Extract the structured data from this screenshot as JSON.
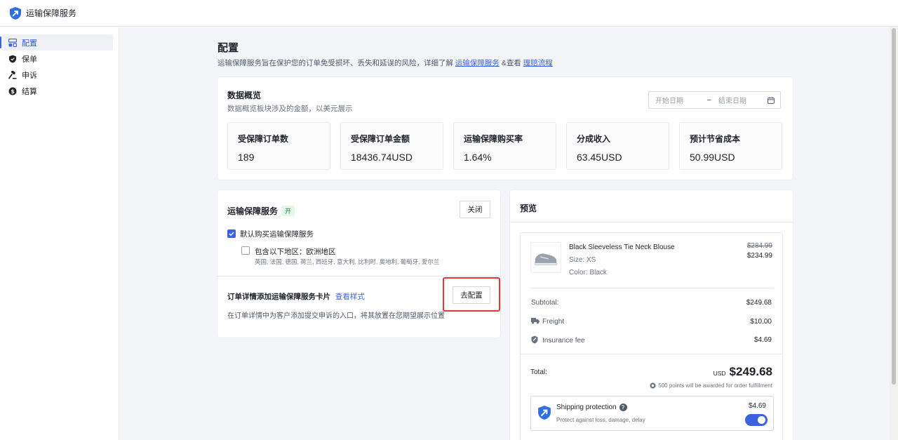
{
  "app": {
    "title": "运输保障服务"
  },
  "sidebar": {
    "items": [
      {
        "label": "配置",
        "icon": "settings-grid-icon",
        "active": true
      },
      {
        "label": "保单",
        "icon": "shield-icon",
        "active": false
      },
      {
        "label": "申诉",
        "icon": "gavel-icon",
        "active": false
      },
      {
        "label": "结算",
        "icon": "dollar-circle-icon",
        "active": false
      }
    ]
  },
  "page": {
    "title": "配置",
    "desc_prefix": "运输保障服务旨在保护您的订单免受损坏、丢失和延误的风险，详细了解",
    "desc_link1": "运输保障服务",
    "desc_mid": "&查看",
    "desc_link2": "理赔流程"
  },
  "overview": {
    "title": "数据概览",
    "subtitle": "数据概览板块涉及的金额，以美元展示",
    "start_placeholder": "开始日期",
    "separator": "–",
    "end_placeholder": "结束日期",
    "stats": [
      {
        "label": "受保障订单数",
        "value": "189"
      },
      {
        "label": "受保障订单金额",
        "value": "18436.74USD"
      },
      {
        "label": "运输保障购买率",
        "value": "1.64%"
      },
      {
        "label": "分成收入",
        "value": "63.45USD"
      },
      {
        "label": "预计节省成本",
        "value": "50.99USD"
      }
    ]
  },
  "service": {
    "title": "运输保障服务",
    "status_tag": "开",
    "close_button": "关闭",
    "default_buy_label": "默认购买运输保障服务",
    "region_label": "包含以下地区：欧洲地区",
    "region_list": "英国, 法国, 德国, 荷兰, 西班牙, 意大利, 比利时, 奥地利, 葡萄牙, 爱尔兰",
    "card_title": "订单详情添加运输保障服务卡片",
    "card_link": "查看样式",
    "card_desc": "在订单详情中为客户添加提交申诉的入口，将其放置在您期望展示位置",
    "configure_button": "去配置"
  },
  "preview": {
    "title": "预览",
    "product": {
      "name": "Black Sleeveless Tie Neck Blouse",
      "size": "Size: XS",
      "color": "Color: Black",
      "old_price": "$284.99",
      "price": "$234.99"
    },
    "subtotal_label": "Subtotal:",
    "subtotal": "$249.68",
    "freight_label": "Freight",
    "freight": "$10.00",
    "insurance_label": "Insurance fee",
    "insurance": "$4.69",
    "total_label": "Total:",
    "currency": "USD",
    "total": "$249.68",
    "points_note": "500 points will be awarded for order fulfillment",
    "protection": {
      "title": "Shipping protection",
      "desc": "Protect against loss, damage, delay",
      "price": "$4.69",
      "enabled": true
    }
  },
  "colors": {
    "accent": "#3b63e0",
    "highlight_border": "#e53935",
    "tag_bg": "#e3f6e8",
    "tag_text": "#1f8a3f"
  }
}
